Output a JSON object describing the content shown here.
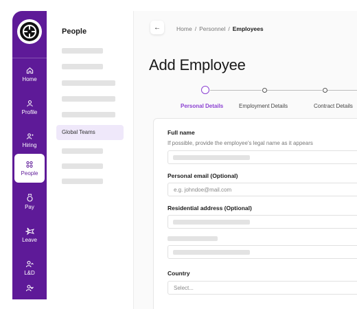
{
  "colors": {
    "brand": "#5e1a98",
    "accent": "#8a3fd1"
  },
  "nav": {
    "items": [
      {
        "label": "Home",
        "icon": "home-icon"
      },
      {
        "label": "Profile",
        "icon": "profile-icon"
      },
      {
        "label": "Hiring",
        "icon": "hiring-icon"
      },
      {
        "label": "People",
        "icon": "people-icon",
        "active": true
      },
      {
        "label": "Pay",
        "icon": "pay-icon"
      },
      {
        "label": "Leave",
        "icon": "leave-icon"
      },
      {
        "label": "L&D",
        "icon": "learning-icon"
      }
    ]
  },
  "side_panel": {
    "title": "People",
    "active_item": "Global Teams"
  },
  "breadcrumb": {
    "items": [
      "Home",
      "Personnel",
      "Employees"
    ],
    "separator": "/"
  },
  "page": {
    "title": "Add Employee"
  },
  "stepper": {
    "steps": [
      "Personal Details",
      "Employment Details",
      "Contract Details"
    ],
    "active_index": 0
  },
  "form": {
    "full_name": {
      "label": "Full name",
      "help": "If possible, provide the employee's legal name as it appears"
    },
    "personal_email": {
      "label": "Personal email (Optional)",
      "placeholder": "e.g. johndoe@mail.com"
    },
    "residential_address": {
      "label": "Residential address (Optional)"
    },
    "country": {
      "label": "Country",
      "placeholder": "Select..."
    }
  }
}
